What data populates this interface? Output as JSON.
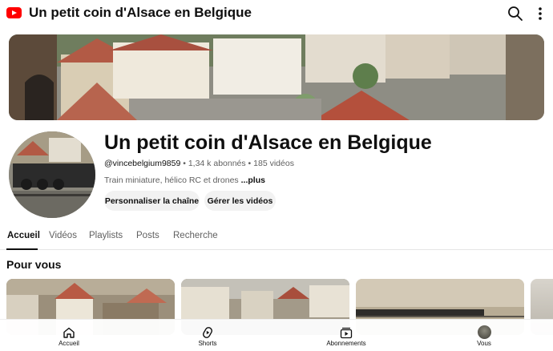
{
  "top_bar": {
    "title": "Un petit coin d'Alsace en Belgique",
    "logo_icon": "youtube-logo-icon",
    "search_icon": "search-icon",
    "more_icon": "more-vertical-icon"
  },
  "channel": {
    "name": "Un petit coin d'Alsace en Belgique",
    "handle": "@vincebelgium9859",
    "subscribers": "1,34 k abonnés",
    "separator": " • ",
    "videos": "185 vidéos",
    "description": "Train miniature, hélico RC et drones ",
    "more_label": "...plus",
    "customize_button": "Personnaliser la chaîne",
    "manage_button": "Gérer les vidéos"
  },
  "tabs": [
    {
      "label": "Accueil",
      "active": true
    },
    {
      "label": "Vidéos",
      "active": false
    },
    {
      "label": "Playlists",
      "active": false
    },
    {
      "label": "Posts",
      "active": false
    },
    {
      "label": "Recherche",
      "active": false
    }
  ],
  "section": {
    "title": "Pour vous"
  },
  "bottom_nav": [
    {
      "label": "Accueil",
      "icon": "home-icon"
    },
    {
      "label": "Shorts",
      "icon": "shorts-icon"
    },
    {
      "label": "Abonnements",
      "icon": "subscriptions-icon"
    },
    {
      "label": "Vous",
      "icon": "user-avatar-icon"
    }
  ],
  "colors": {
    "brand_red": "#ff0000",
    "text_primary": "#0f0f0f",
    "text_secondary": "#606060",
    "pill_bg": "#f2f2f2"
  }
}
